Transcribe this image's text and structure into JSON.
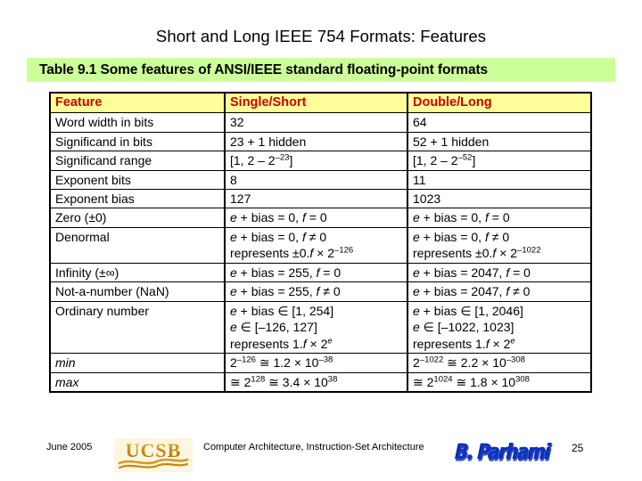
{
  "slide": {
    "title": "Short and Long IEEE 754 Formats: Features",
    "caption": "Table 9.1  Some features of ANSI/IEEE standard floating-point formats"
  },
  "colors": {
    "caption_banner": "#ccff99",
    "header_row_bg": "#ffff99",
    "header_text": "#cc0000",
    "body_text": "#000000",
    "ucsb_gold": "#c8860c",
    "parhami_blue": "#1133bb"
  },
  "table": {
    "headers": [
      "Feature",
      "Single/Short",
      "Double/Long"
    ],
    "rows": [
      {
        "feature": "Word width in bits",
        "single": "32",
        "double": "64"
      },
      {
        "feature": "Significand in bits",
        "single": "23 + 1 hidden",
        "double": "52 + 1 hidden"
      },
      {
        "feature": "Significand range",
        "single": "[1, 2 – 2^-23]",
        "double": "[1, 2 – 2^-52]"
      },
      {
        "feature": "Exponent bits",
        "single": "8",
        "double": "11"
      },
      {
        "feature": "Exponent bias",
        "single": "127",
        "double": "1023"
      },
      {
        "feature": "Zero (±0)",
        "single": "e + bias = 0, f = 0",
        "double": "e + bias = 0, f = 0"
      },
      {
        "feature": "Denormal",
        "single": "e + bias = 0, f ≠ 0 represents ±0.f × 2^-126",
        "double": "e + bias = 0, f ≠ 0 represents ±0.f × 2^-1022"
      },
      {
        "feature": "Infinity (±∞)",
        "single": "e + bias = 255, f = 0",
        "double": "e + bias = 2047, f = 0"
      },
      {
        "feature": "Not-a-number (NaN)",
        "single": "e + bias = 255, f ≠ 0",
        "double": "e + bias = 2047, f ≠ 0"
      },
      {
        "feature": "Ordinary number",
        "single": "e + bias ∈ [1, 254] e ∈ [–126, 127] represents 1.f × 2^e",
        "double": "e + bias ∈ [1, 2046] e ∈ [–1022, 1023] represents 1.f × 2^e"
      },
      {
        "feature": "min",
        "single": "2^-126 ≅ 1.2 × 10^-38",
        "double": "2^-1022 ≅ 2.2 × 10^-308"
      },
      {
        "feature": "max",
        "single": "≅ 2^128 ≅ 3.4 × 10^38",
        "double": "≅ 2^1024 ≅ 1.8 × 10^308"
      }
    ]
  },
  "footer": {
    "date": "June 2005",
    "center_text": "Computer Architecture, Instruction-Set Architecture",
    "page_number": "25",
    "ucsb_logo_text": "UCSB",
    "parhami_logo_text": "B. Parhami"
  }
}
